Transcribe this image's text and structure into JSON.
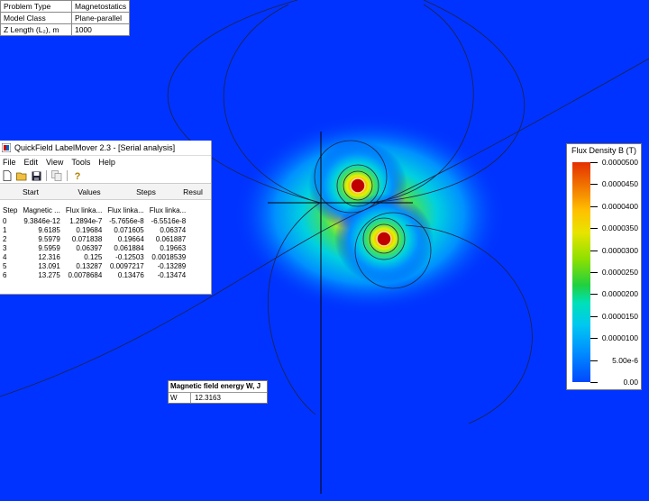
{
  "problem_info": [
    {
      "key": "Problem Type",
      "value": "Magnetostatics"
    },
    {
      "key": "Model Class",
      "value": "Plane-parallel"
    },
    {
      "key": "Z Length (L₂), m",
      "value": "1000"
    }
  ],
  "labelmover": {
    "title": "QuickField LabelMover 2.3 - [Serial analysis]",
    "menu": [
      "File",
      "Edit",
      "View",
      "Tools",
      "Help"
    ],
    "toolbar_icons": [
      "new-file-icon",
      "open-folder-icon",
      "save-icon",
      "copy-icon",
      "help-icon"
    ],
    "header_cols": [
      "Start",
      "Values",
      "Steps",
      "Resul"
    ],
    "table": {
      "columns": [
        "Step",
        "Magnetic ...",
        "Flux linka...",
        "Flux linka...",
        "Flux linka..."
      ],
      "rows": [
        [
          "0",
          "9.3846e-12",
          "1.2894e-7",
          "-5.7656e-8",
          "-6.5516e-8"
        ],
        [
          "1",
          "9.6185",
          "0.19684",
          "0.071605",
          "0.06374"
        ],
        [
          "2",
          "9.5979",
          "0.071838",
          "0.19664",
          "0.061887"
        ],
        [
          "3",
          "9.5959",
          "0.06397",
          "0.061884",
          "0.19663"
        ],
        [
          "4",
          "12.316",
          "0.125",
          "-0.12503",
          "0.0018539"
        ],
        [
          "5",
          "13.091",
          "0.13287",
          "0.0097217",
          "-0.13289"
        ],
        [
          "6",
          "13.275",
          "0.0078684",
          "0.13476",
          "-0.13474"
        ]
      ]
    }
  },
  "energy": {
    "title": "Magnetic field energy W, J",
    "label": "W",
    "value": "12.3163"
  },
  "legend": {
    "title": "Flux Density B (T)",
    "labels": [
      "0.0000500",
      "0.0000450",
      "0.0000400",
      "0.0000350",
      "0.0000300",
      "0.0000250",
      "0.0000200",
      "0.0000150",
      "0.0000100",
      "5.00e-6",
      "0.00"
    ]
  },
  "colors": {
    "background": "#0033ff",
    "conductor": "#c00000",
    "field_line": "#222244"
  }
}
